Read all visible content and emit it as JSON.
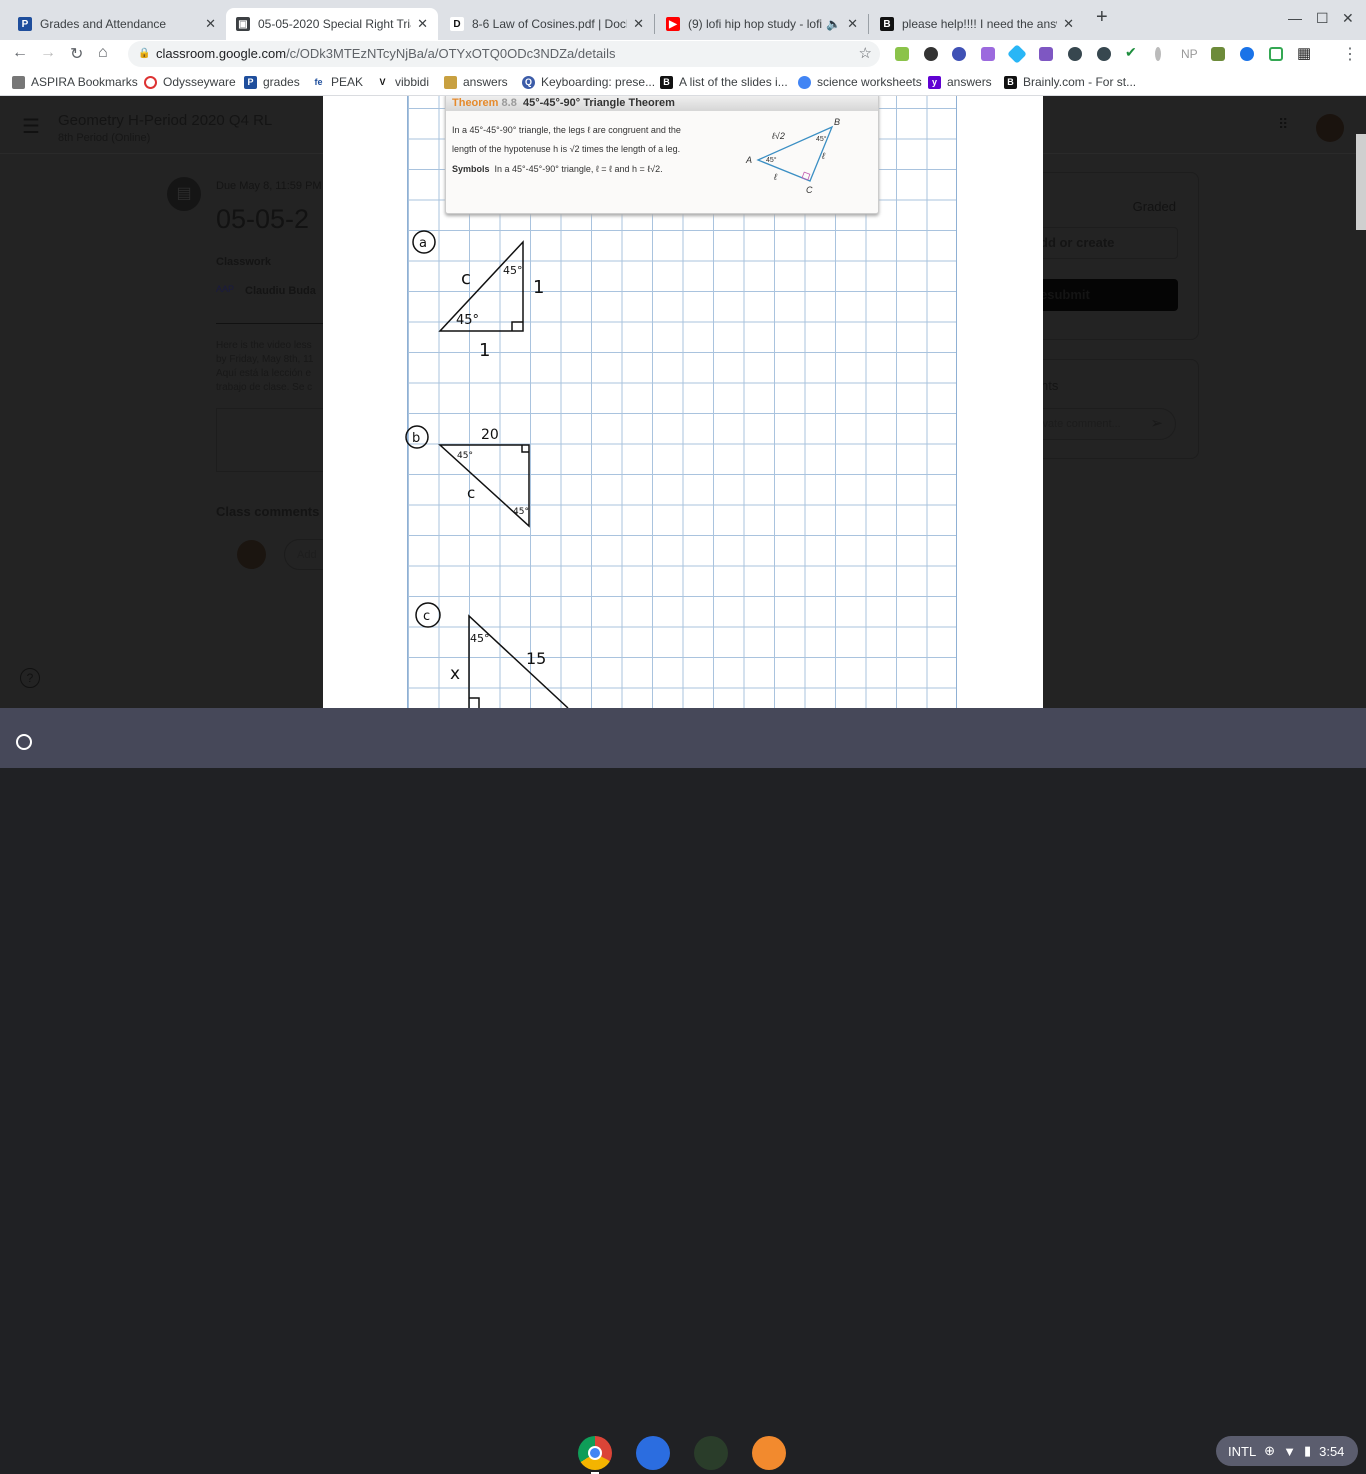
{
  "tabs": [
    {
      "title": "Grades and Attendance",
      "icon": "powerschool-icon",
      "color": "#1f4e9c"
    },
    {
      "title": "05-05-2020 Special Right Triang",
      "icon": "classroom-icon",
      "color": "#3c4043",
      "active": true
    },
    {
      "title": "8-6 Law of Cosines.pdf | DocHub",
      "icon": "dochub-icon",
      "color": "#111"
    },
    {
      "title": "(9) lofi hip hop study - lofi hi",
      "icon": "youtube-icon",
      "color": "#ff0000"
    },
    {
      "title": "please help!!!! I need the answers",
      "icon": "brainly-icon",
      "color": "#111"
    }
  ],
  "address": {
    "host": "classroom.google.com",
    "path": "/c/ODk3MTEzNTcyNjBa/a/OTYxOTQ0ODc3NDZa/details"
  },
  "bookmarks": [
    "ASPIRA Bookmarks",
    "Odysseyware",
    "grades",
    "PEAK",
    "vibbidi",
    "answers",
    "Keyboarding: prese...",
    "A list of the slides i...",
    "science worksheets",
    "answers",
    "Brainly.com - For st..."
  ],
  "classroom": {
    "class_title": "Geometry H-Period 2020 Q4 RL",
    "class_subtitle": "8th Period (Online)",
    "due": "Due May 8, 11:59 PM",
    "assignment_title": "05-05-2",
    "category": "Classwork",
    "teacher": "Claudiu Buda",
    "desc": [
      "Here is the video less",
      "by Friday, May 8th, 11",
      "Aquí está la lección e",
      "trabajo de clase. Se c"
    ],
    "class_comments": "Class comments",
    "comment_placeholder": "Add",
    "status": "Graded",
    "add_create": "dd or create",
    "resubmit": "esubmit",
    "private_comments": "nts",
    "private_placeholder": "ivate comment..."
  },
  "theorem": {
    "label": "Theorem",
    "number": "8.8",
    "title": "45°-45°-90° Triangle Theorem",
    "line1": "In a 45°-45°-90° triangle, the legs ℓ are congruent and the",
    "line2": "length of the hypotenuse h is √2 times the length of a leg.",
    "symbols_label": "Symbols",
    "symbols": "In a 45°-45°-90° triangle, ℓ = ℓ and h = ℓ√2.",
    "fig": {
      "A": "A",
      "B": "B",
      "C": "C",
      "hyp": "ℓ√2",
      "leg": "ℓ",
      "angle": "45°"
    }
  },
  "handwriting": {
    "a": {
      "tag": "a",
      "hyp": "c",
      "angle": "45°",
      "leg": "1"
    },
    "b": {
      "tag": "b",
      "top": "20",
      "angle": "45°",
      "hyp": "c"
    },
    "c": {
      "tag": "c",
      "angle": "45°",
      "hyp": "15",
      "leg": "x"
    }
  },
  "tray": {
    "ime": "INTL",
    "time": "3:54"
  }
}
